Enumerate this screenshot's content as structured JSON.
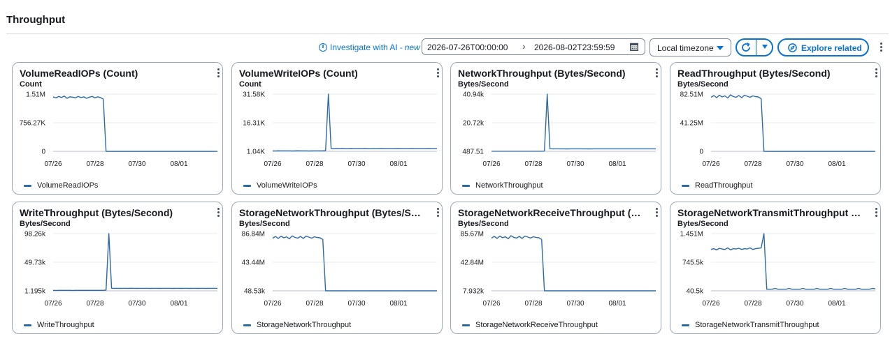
{
  "page": {
    "title": "Throughput"
  },
  "toolbar": {
    "ai_link": {
      "label": "Investigate with AI",
      "separator": "-",
      "badge": "new"
    },
    "date_range": {
      "start": "2026-07-26T00:00:00",
      "end": "2026-08-02T23:59:59"
    },
    "timezone": {
      "selected": "Local timezone"
    },
    "explore_label": "Explore related"
  },
  "colors": {
    "series": "#2c6aa5",
    "accent": "#0972d3",
    "grid": "#e9ebed"
  },
  "chart_data": [
    {
      "type": "line",
      "title": "VolumeReadIOPs (Count)",
      "ylabel": "Count",
      "yticks": [
        "1.51M",
        "756.27K",
        "0"
      ],
      "ylim": [
        0,
        1510000
      ],
      "xticks": [
        "07/26",
        "07/28",
        "07/30",
        "08/01"
      ],
      "legend": "VolumeReadIOPs",
      "series": [
        {
          "name": "VolumeReadIOPs",
          "values": [
            1440000,
            1410000,
            1450000,
            1420000,
            1460000,
            1400000,
            1440000,
            1430000,
            1410000,
            1450000,
            1420000,
            1440000,
            1400000,
            1430000,
            1450000,
            1410000,
            1440000,
            1420000,
            1380000,
            0,
            0,
            0,
            0,
            0,
            0,
            0,
            0,
            0,
            0,
            0,
            0,
            0,
            0,
            0,
            0,
            0,
            0,
            0,
            0,
            0,
            0,
            0,
            0,
            0,
            0,
            0,
            0,
            0,
            0,
            0,
            0,
            0,
            0,
            0,
            0,
            0,
            0,
            0,
            0,
            0
          ]
        }
      ]
    },
    {
      "type": "line",
      "title": "VolumeWriteIOPs (Count)",
      "ylabel": "Count",
      "yticks": [
        "31.58K",
        "16.31K",
        "1.04K"
      ],
      "ylim": [
        1040,
        31580
      ],
      "xticks": [
        "07/26",
        "07/28",
        "07/30",
        "08/01"
      ],
      "legend": "VolumeWriteIOPs",
      "series": [
        {
          "name": "VolumeWriteIOPs",
          "values": [
            1300,
            1280,
            1320,
            1300,
            1290,
            1310,
            1300,
            1280,
            1300,
            1320,
            1290,
            1300,
            1310,
            1280,
            1300,
            1290,
            1310,
            1300,
            1300,
            1400,
            31580,
            2600,
            2500,
            2550,
            2480,
            2520,
            2500,
            2460,
            2530,
            2500,
            2480,
            2510,
            2490,
            2520,
            2500,
            2470,
            2510,
            2500,
            2490,
            2520,
            2480,
            2500,
            2510,
            2490,
            2500,
            2520,
            2480,
            2510,
            2500,
            2490,
            2520,
            2500,
            2480,
            2510,
            2500,
            2490,
            2520,
            2500,
            2490,
            2510
          ]
        }
      ]
    },
    {
      "type": "line",
      "title": "NetworkThroughput (Bytes/Second)",
      "ylabel": "Bytes/Second",
      "yticks": [
        "40.94k",
        "20.72k",
        "487.51"
      ],
      "ylim": [
        487.51,
        40940
      ],
      "xticks": [
        "07/26",
        "07/28",
        "07/30",
        "08/01"
      ],
      "legend": "NetworkThroughput",
      "series": [
        {
          "name": "NetworkThroughput",
          "values": [
            600,
            580,
            610,
            600,
            590,
            605,
            600,
            585,
            600,
            610,
            595,
            600,
            605,
            590,
            600,
            595,
            605,
            600,
            600,
            700,
            40940,
            2300,
            2250,
            2280,
            2240,
            2270,
            2250,
            2230,
            2280,
            2260,
            2240,
            2270,
            2250,
            2280,
            2260,
            2230,
            2270,
            2250,
            2240,
            2280,
            2260,
            2250,
            2270,
            2240,
            2260,
            2280,
            2250,
            2270,
            2260,
            2240,
            2280,
            2260,
            2250,
            2270,
            2260,
            2240,
            2280,
            2250,
            2260,
            2270
          ]
        }
      ]
    },
    {
      "type": "line",
      "title": "ReadThroughput (Bytes/Second)",
      "ylabel": "Bytes/Second",
      "yticks": [
        "82.51M",
        "41.25M",
        "0"
      ],
      "ylim": [
        0,
        82510000
      ],
      "xticks": [
        "07/26",
        "07/28",
        "07/30",
        "08/01"
      ],
      "legend": "ReadThroughput",
      "series": [
        {
          "name": "ReadThroughput",
          "values": [
            78000000,
            80500000,
            77500000,
            81000000,
            78500000,
            80000000,
            77000000,
            81500000,
            79000000,
            78000000,
            80500000,
            77500000,
            81000000,
            79500000,
            78000000,
            80000000,
            79000000,
            78500000,
            76000000,
            0,
            0,
            0,
            0,
            0,
            0,
            0,
            0,
            0,
            0,
            0,
            0,
            0,
            0,
            0,
            0,
            0,
            0,
            0,
            0,
            0,
            0,
            0,
            0,
            0,
            0,
            0,
            0,
            0,
            0,
            0,
            0,
            0,
            0,
            0,
            0,
            0,
            0,
            0,
            0,
            0
          ]
        }
      ]
    },
    {
      "type": "line",
      "title": "WriteThroughput (Bytes/Second)",
      "ylabel": "Bytes/Second",
      "yticks": [
        "98.26k",
        "49.73k",
        "1.195k"
      ],
      "ylim": [
        1195,
        98260
      ],
      "xticks": [
        "07/26",
        "07/28",
        "07/30",
        "08/01"
      ],
      "legend": "WriteThroughput",
      "series": [
        {
          "name": "WriteThroughput",
          "values": [
            2000,
            1950,
            2050,
            2000,
            1980,
            2020,
            2000,
            1960,
            2010,
            2040,
            1990,
            2000,
            2020,
            1970,
            2000,
            1990,
            2030,
            2000,
            2000,
            2400,
            98260,
            5600,
            5400,
            5500,
            5350,
            5450,
            5500,
            5300,
            5550,
            5400,
            5350,
            5500,
            5420,
            5480,
            5400,
            5330,
            5460,
            5400,
            5380,
            5500,
            5420,
            5400,
            5470,
            5390,
            5420,
            5500,
            5380,
            5460,
            5420,
            5390,
            5500,
            5430,
            5380,
            5460,
            5420,
            5390,
            5510,
            5400,
            5430,
            5460
          ]
        }
      ]
    },
    {
      "type": "line",
      "title": "StorageNetworkThroughput (Bytes/Second)",
      "ylabel": "Bytes/Second",
      "yticks": [
        "86.84M",
        "43.44M",
        "48.53k"
      ],
      "ylim": [
        48530,
        86840000
      ],
      "xticks": [
        "07/26",
        "07/28",
        "07/30",
        "08/01"
      ],
      "legend": "StorageNetworkThroughput",
      "series": [
        {
          "name": "StorageNetworkThroughput",
          "values": [
            80000000,
            82500000,
            79500000,
            83000000,
            80500000,
            82000000,
            79000000,
            83500000,
            81000000,
            80000000,
            82500000,
            79500000,
            83000000,
            81500000,
            80000000,
            82000000,
            81000000,
            80500000,
            78000000,
            100000,
            100000,
            100000,
            100000,
            100000,
            100000,
            100000,
            100000,
            100000,
            100000,
            100000,
            100000,
            100000,
            100000,
            100000,
            100000,
            100000,
            100000,
            100000,
            100000,
            100000,
            100000,
            100000,
            100000,
            100000,
            100000,
            100000,
            100000,
            100000,
            100000,
            100000,
            100000,
            100000,
            100000,
            100000,
            100000,
            100000,
            100000,
            100000,
            100000,
            100000
          ]
        }
      ]
    },
    {
      "type": "line",
      "title": "StorageNetworkReceiveThroughput (Bytes/Second)",
      "ylabel": "Bytes/Second",
      "yticks": [
        "85.67M",
        "42.84M",
        "7.932k"
      ],
      "ylim": [
        7932,
        85670000
      ],
      "xticks": [
        "07/26",
        "07/28",
        "07/30",
        "08/01"
      ],
      "legend": "StorageNetworkReceiveThroughput",
      "series": [
        {
          "name": "StorageNetworkReceiveThroughput",
          "values": [
            79000000,
            81500000,
            78500000,
            82000000,
            79500000,
            81000000,
            78000000,
            82500000,
            80000000,
            79000000,
            81500000,
            78500000,
            82000000,
            80500000,
            79000000,
            81000000,
            80000000,
            79500000,
            77000000,
            60000,
            60000,
            60000,
            60000,
            60000,
            60000,
            60000,
            60000,
            60000,
            60000,
            60000,
            60000,
            60000,
            60000,
            60000,
            60000,
            60000,
            60000,
            60000,
            60000,
            60000,
            60000,
            60000,
            60000,
            60000,
            60000,
            60000,
            60000,
            60000,
            60000,
            60000,
            60000,
            60000,
            60000,
            60000,
            60000,
            60000,
            60000,
            60000,
            60000,
            60000
          ]
        }
      ]
    },
    {
      "type": "line",
      "title": "StorageNetworkTransmitThroughput (Bytes/Second)",
      "ylabel": "Bytes/Second",
      "yticks": [
        "1.451M",
        "745.5k",
        "40.5k"
      ],
      "ylim": [
        40500,
        1451000
      ],
      "xticks": [
        "07/26",
        "07/28",
        "07/30",
        "08/01"
      ],
      "legend": "StorageNetworkTransmitThroughput",
      "series": [
        {
          "name": "StorageNetworkTransmitThroughput",
          "values": [
            1060000,
            1080000,
            1050000,
            1090000,
            1070000,
            1060000,
            1100000,
            1050000,
            1080000,
            1070000,
            1090000,
            1060000,
            1080000,
            1070000,
            1100000,
            1060000,
            1080000,
            1090000,
            1100000,
            1451000,
            80000,
            80000,
            80000,
            100000,
            80000,
            80000,
            80000,
            80000,
            100000,
            80000,
            80000,
            80000,
            80000,
            100000,
            80000,
            80000,
            80000,
            80000,
            100000,
            80000,
            80000,
            80000,
            80000,
            100000,
            80000,
            80000,
            80000,
            80000,
            100000,
            80000,
            80000,
            80000,
            80000,
            100000,
            80000,
            80000,
            80000,
            80000,
            100000,
            90000
          ]
        }
      ]
    }
  ]
}
